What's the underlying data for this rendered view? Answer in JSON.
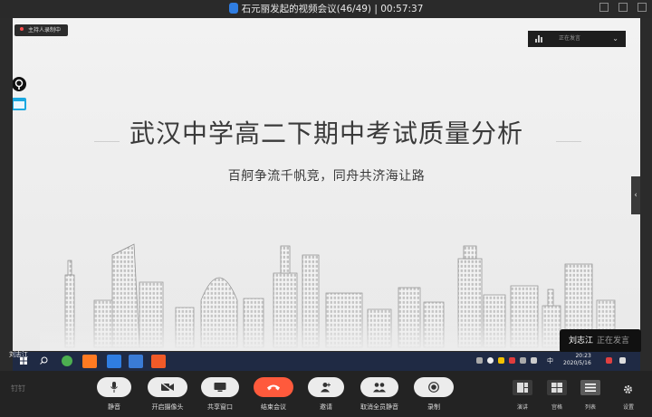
{
  "window": {
    "title": "石元丽发起的视频会议(46/49) | 00:57:37"
  },
  "share": {
    "recording_badge": "主持人录制中",
    "speaking_header": "正在发言",
    "slide_title": "武汉中学高二下期中考试质量分析",
    "slide_subtitle": "百舸争流千帆竞，同舟共济海让路",
    "side_tab_glyph": "‹"
  },
  "speaker_popup": {
    "name": "刘志江",
    "status": "正在发言"
  },
  "taskbar": {
    "user_name": "刘志江",
    "time": "20:23",
    "date": "2020/5/16",
    "ime": "中"
  },
  "toolbar": {
    "logo": "钉钉",
    "buttons": [
      {
        "label": "静音",
        "icon": "microphone-icon"
      },
      {
        "label": "开启摄像头",
        "icon": "camera-off-icon"
      },
      {
        "label": "共享窗口",
        "icon": "screen-share-icon"
      },
      {
        "label": "结束会议",
        "icon": "hang-up-icon"
      },
      {
        "label": "邀请",
        "icon": "invite-user-icon"
      },
      {
        "label": "取消全员静音",
        "icon": "group-unmute-icon"
      },
      {
        "label": "录制",
        "icon": "record-icon"
      }
    ],
    "right_buttons": [
      {
        "label": "演讲",
        "icon": "speaker-view-icon"
      },
      {
        "label": "宫格",
        "icon": "grid-view-icon"
      },
      {
        "label": "列表",
        "icon": "list-view-icon"
      },
      {
        "label": "设置",
        "icon": "gear-icon"
      }
    ]
  },
  "colors": {
    "accent_red": "#ff5a3c",
    "toolbar_bg": "#232323",
    "taskbar_bg": "#1f2a44"
  }
}
